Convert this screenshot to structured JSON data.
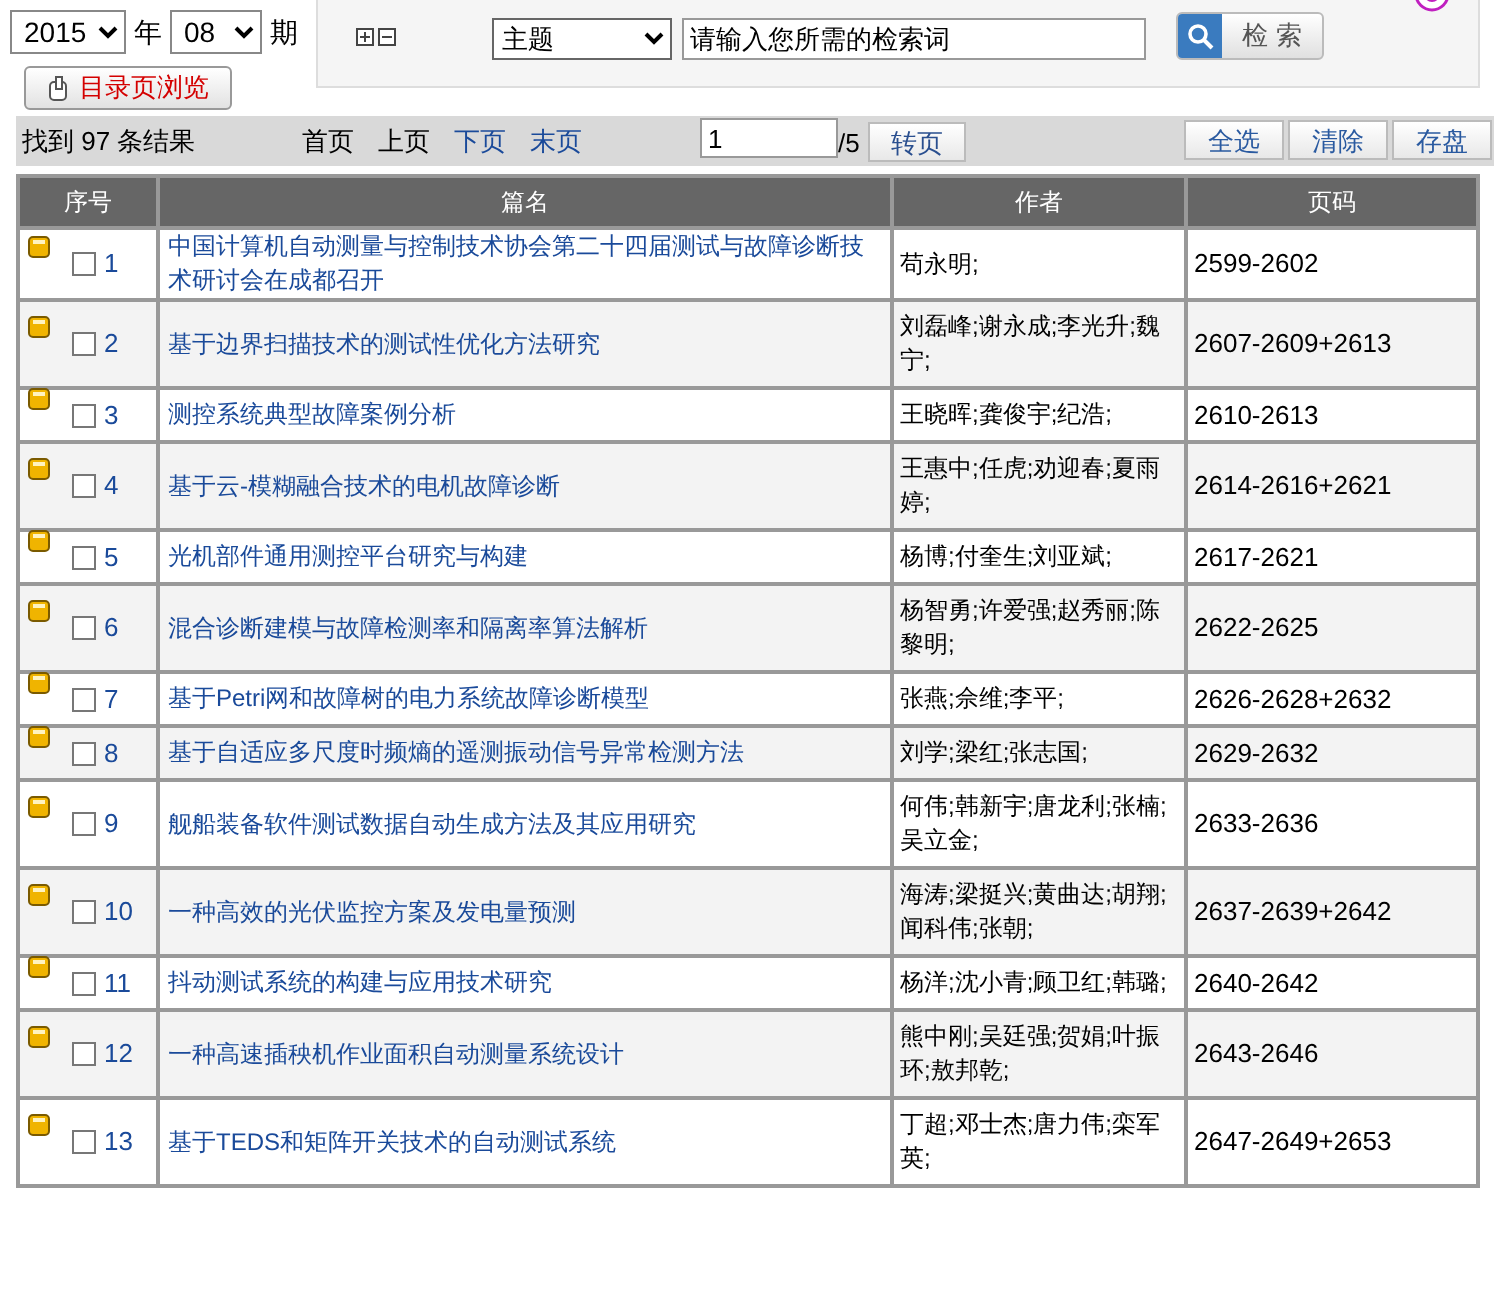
{
  "issue": {
    "year": "2015",
    "year_label": "年",
    "number": "08",
    "number_label": "期"
  },
  "toc_button": "目录页浏览",
  "search": {
    "field": "主题",
    "placeholder": "请输入您所需的检索词",
    "button": "检 索"
  },
  "toolbar": {
    "result_count": "找到 97 条结果",
    "pager": [
      {
        "label": "首页",
        "disabled": true
      },
      {
        "label": "上页",
        "disabled": true
      },
      {
        "label": "下页",
        "disabled": false
      },
      {
        "label": "末页",
        "disabled": false
      }
    ],
    "page_value": "1",
    "page_total": "/5",
    "go_button": "转页",
    "actions": [
      "全选",
      "清除",
      "存盘"
    ]
  },
  "table": {
    "columns": [
      "序号",
      "篇名",
      "作者",
      "页码"
    ],
    "rows": [
      {
        "no": "1",
        "checked": false,
        "title": "中国计算机自动测量与控制技术协会第二十四届测试与故障诊断技术研讨会在成都召开",
        "authors": "苟永明;",
        "pages": "2599-2602"
      },
      {
        "no": "2",
        "checked": false,
        "title": "基于边界扫描技术的测试性优化方法研究",
        "authors": "刘磊峰;谢永成;李光升;魏宁;",
        "pages": "2607-2609+2613"
      },
      {
        "no": "3",
        "checked": false,
        "title": "测控系统典型故障案例分析",
        "authors": "王晓晖;龚俊宇;纪浩;",
        "pages": "2610-2613"
      },
      {
        "no": "4",
        "checked": false,
        "title": "基于云-模糊融合技术的电机故障诊断",
        "authors": "王惠中;任虎;劝迎春;夏雨婷;",
        "pages": "2614-2616+2621"
      },
      {
        "no": "5",
        "checked": false,
        "title": "光机部件通用测控平台研究与构建",
        "authors": "杨博;付奎生;刘亚斌;",
        "pages": "2617-2621"
      },
      {
        "no": "6",
        "checked": false,
        "title": "混合诊断建模与故障检测率和隔离率算法解析",
        "authors": "杨智勇;许爱强;赵秀丽;陈黎明;",
        "pages": "2622-2625"
      },
      {
        "no": "7",
        "checked": false,
        "title": "基于Petri网和故障树的电力系统故障诊断模型",
        "authors": "张燕;佘维;李平;",
        "pages": "2626-2628+2632"
      },
      {
        "no": "8",
        "checked": false,
        "title": "基于自适应多尺度时频熵的遥测振动信号异常检测方法",
        "authors": "刘学;梁红;张志国;",
        "pages": "2629-2632"
      },
      {
        "no": "9",
        "checked": false,
        "title": "舰船装备软件测试数据自动生成方法及其应用研究",
        "authors": "何伟;韩新宇;唐龙利;张楠;吴立金;",
        "pages": "2633-2636"
      },
      {
        "no": "10",
        "checked": false,
        "title": "一种高效的光伏监控方案及发电量预测",
        "authors": "海涛;梁挺兴;黄曲达;胡翔;闻科伟;张朝;",
        "pages": "2637-2639+2642"
      },
      {
        "no": "11",
        "checked": false,
        "title": "抖动测试系统的构建与应用技术研究",
        "authors": "杨洋;沈小青;顾卫红;韩璐;",
        "pages": "2640-2642"
      },
      {
        "no": "12",
        "checked": false,
        "title": "一种高速插秧机作业面积自动测量系统设计",
        "authors": "熊中刚;吴廷强;贺娟;叶振环;敖邦乾;",
        "pages": "2643-2646"
      },
      {
        "no": "13",
        "checked": false,
        "title": "基于TEDS和矩阵开关技术的自动测试系统",
        "authors": "丁超;邓士杰;唐力伟;栾军英;",
        "pages": "2647-2649+2653"
      }
    ]
  }
}
